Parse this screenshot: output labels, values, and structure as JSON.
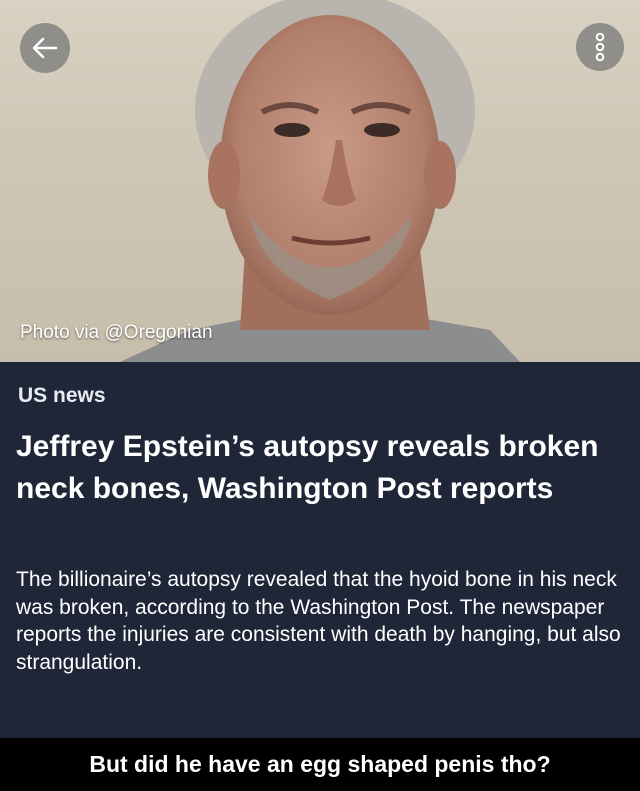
{
  "header": {
    "photo_credit": "Photo via @Oregonian",
    "back_icon": "arrow-left-icon",
    "more_icon": "more-vertical-icon"
  },
  "article": {
    "section": "US news",
    "headline": "Jeffrey Epstein’s autopsy reveals broken neck bones, Washington Post reports",
    "summary": "The billionaire’s autopsy revealed that the hyoid bone in his neck was broken, according to the Washington Post. The newspaper reports the injuries are consistent with death by hanging, but also strangulation."
  },
  "caption": {
    "text": "But did he have an egg shaped penis tho?"
  },
  "colors": {
    "article_bg": "#1e2638",
    "button_bg": "#7a7a7a",
    "caption_bg": "#000000"
  }
}
